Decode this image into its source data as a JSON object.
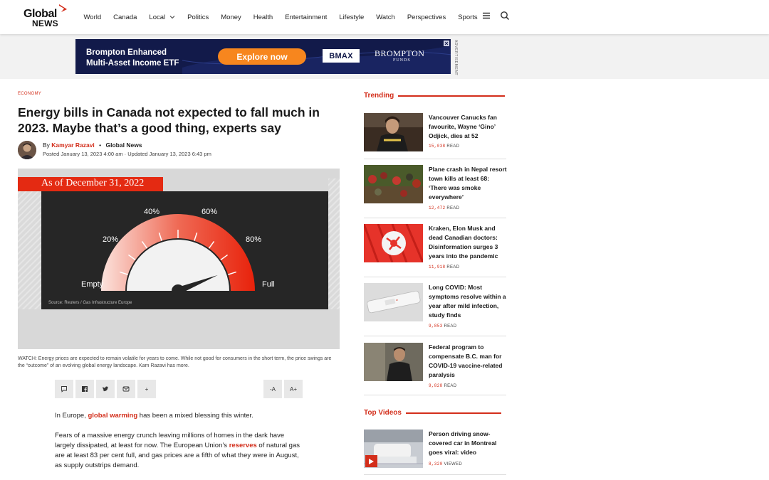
{
  "header": {
    "logo_top": "Global",
    "logo_bottom": "NEWS",
    "nav": [
      "World",
      "Canada",
      "Local",
      "Politics",
      "Money",
      "Health",
      "Entertainment",
      "Lifestyle",
      "Watch",
      "Perspectives",
      "Sports"
    ]
  },
  "ad": {
    "headline_line1": "Brompton Enhanced",
    "headline_line2": "Multi-Asset Income ETF",
    "cta": "Explore now",
    "ticker": "BMAX",
    "brand": "BROMPTON",
    "brand_sub": "FUNDS",
    "label": "ADVERTISEMENT"
  },
  "article": {
    "category": "ECONOMY",
    "title": "Energy bills in Canada not expected to fall much in 2023. Maybe that’s a good thing, experts say",
    "by": "By",
    "author": "Kamyar Razavi",
    "source": "Global News",
    "dates": "Posted January 13, 2023 4:00 am · Updated January 13, 2023 6:43 pm",
    "video": {
      "banner": "As of December 31, 2022",
      "gauge_labels": {
        "empty": "Empty",
        "p20": "20%",
        "p40": "40%",
        "p60": "60%",
        "p80": "80%",
        "full": "Full"
      },
      "gauge_level": 0.88,
      "source": "Source: Reuters / Gas Infrastructure Europe"
    },
    "caption": "WATCH: Energy prices are expected to remain volatile for years to come. While not good for consumers in the short term, the price swings are the “outcome” of an evolving global energy landscape. Kam Razavi has more.",
    "font_smaller": "-A",
    "font_larger": "A+",
    "share_more": "+",
    "p1_before": "In Europe, ",
    "p1_link": "global warming",
    "p1_after": " has been a mixed blessing this winter.",
    "p2_before": "Fears of a massive energy crunch leaving millions of homes in the dark have largely dissipated, at least for now. The European Union’s ",
    "p2_link": "reserves",
    "p2_after": " of natural gas are at least 83 per cent full, and gas prices are a fifth of what they were in August, as supply outstrips demand."
  },
  "sidebar": {
    "trending_title": "Trending",
    "trending": [
      {
        "headline": "Vancouver Canucks fan favourite, Wayne ‘Gino’ Odjick, dies at 52",
        "count": "15,038",
        "unit": "READ"
      },
      {
        "headline": "Plane crash in Nepal resort town kills at least 68: ‘There was smoke everywhere’",
        "count": "12,472",
        "unit": "READ"
      },
      {
        "headline": "Kraken, Elon Musk and dead Canadian doctors: Disinformation surges 3 years into the pandemic",
        "count": "11,918",
        "unit": "READ"
      },
      {
        "headline": "Long COVID: Most symptoms resolve within a year after mild infection, study finds",
        "count": "9,853",
        "unit": "READ"
      },
      {
        "headline": "Federal program to compensate B.C. man for COVID-19 vaccine-related paralysis",
        "count": "9,828",
        "unit": "READ"
      }
    ],
    "videos_title": "Top Videos",
    "videos": [
      {
        "headline": "Person driving snow-covered car in Montreal goes viral: video",
        "count": "8,320",
        "unit": "VIEWED"
      }
    ]
  },
  "colors": {
    "brand_red": "#d32e1b",
    "ad_navy": "#121a4a",
    "ad_orange": "#f7861e"
  }
}
